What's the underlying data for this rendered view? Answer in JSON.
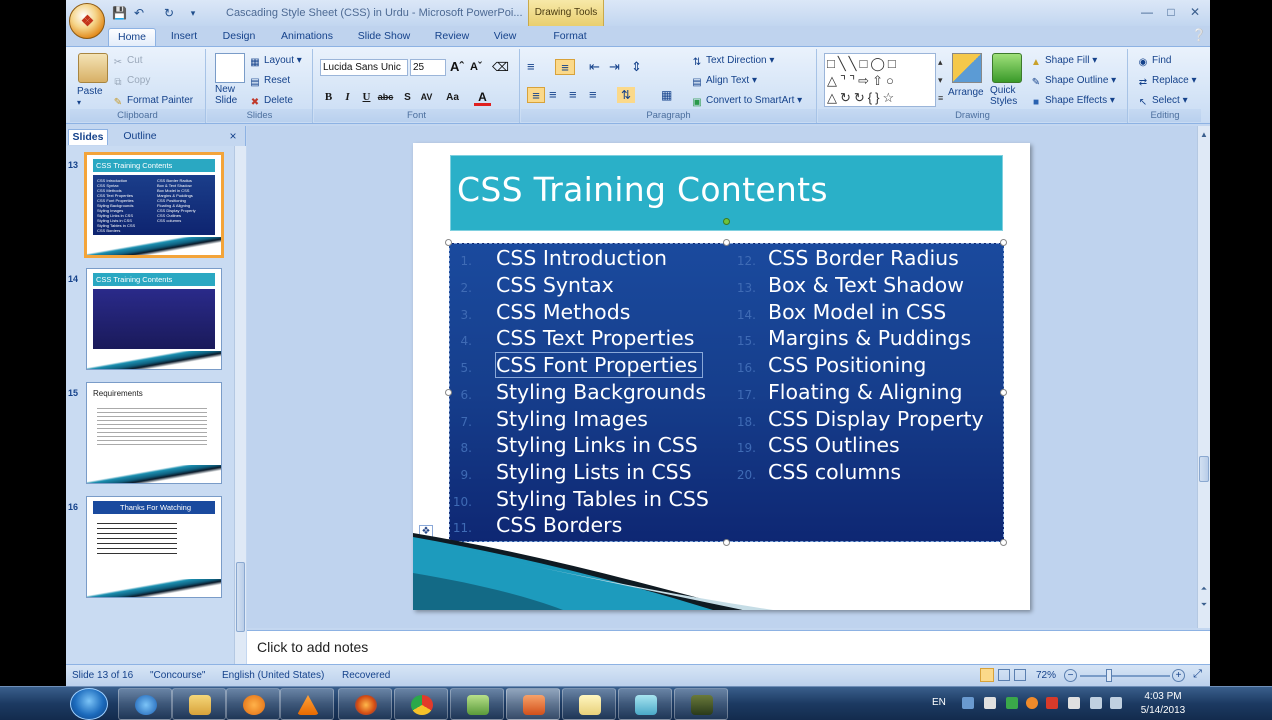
{
  "window": {
    "title": "Cascading Style Sheet (CSS) in Urdu - Microsoft PowerPoi...",
    "context_tab_group": "Drawing Tools"
  },
  "tabs": [
    "Home",
    "Insert",
    "Design",
    "Animations",
    "Slide Show",
    "Review",
    "View",
    "Format"
  ],
  "ribbon": {
    "clipboard": {
      "label": "Clipboard",
      "paste": "Paste",
      "cut": "Cut",
      "copy": "Copy",
      "format_painter": "Format Painter"
    },
    "slides": {
      "label": "Slides",
      "new_slide": "New Slide",
      "new_slide_line1": "New",
      "new_slide_line2": "Slide",
      "layout": "Layout",
      "reset": "Reset",
      "delete": "Delete"
    },
    "font": {
      "label": "Font",
      "family": "Lucida Sans Unic",
      "size": "25"
    },
    "paragraph": {
      "label": "Paragraph",
      "text_direction": "Text Direction",
      "align_text": "Align Text",
      "convert": "Convert to SmartArt"
    },
    "drawing": {
      "label": "Drawing",
      "arrange": "Arrange",
      "quick_styles": "Quick Styles",
      "quick_line1": "Quick",
      "quick_line2": "Styles",
      "shape_fill": "Shape Fill",
      "shape_outline": "Shape Outline",
      "shape_effects": "Shape Effects"
    },
    "editing": {
      "label": "Editing",
      "find": "Find",
      "replace": "Replace",
      "select": "Select"
    }
  },
  "pane": {
    "tab_slides": "Slides",
    "tab_outline": "Outline",
    "close": "×"
  },
  "thumbnails": [
    {
      "num": "13",
      "title": "CSS Training Contents"
    },
    {
      "num": "14",
      "title": "CSS Training Contents"
    },
    {
      "num": "15",
      "title": "Requirements"
    },
    {
      "num": "16",
      "title": "Thanks For Watching"
    }
  ],
  "slide": {
    "title": "CSS Training Contents",
    "left_items": [
      {
        "n": "1.",
        "t": "CSS Introduction"
      },
      {
        "n": "2.",
        "t": "CSS Syntax"
      },
      {
        "n": "3.",
        "t": "CSS Methods"
      },
      {
        "n": "4.",
        "t": "CSS Text Properties"
      },
      {
        "n": "5.",
        "t": "CSS Font Properties"
      },
      {
        "n": "6.",
        "t": "Styling Backgrounds"
      },
      {
        "n": "7.",
        "t": "Styling Images"
      },
      {
        "n": "8.",
        "t": "Styling Links in CSS"
      },
      {
        "n": "9.",
        "t": "Styling Lists in CSS"
      },
      {
        "n": "10.",
        "t": "Styling Tables in CSS"
      },
      {
        "n": "11.",
        "t": "CSS Borders"
      }
    ],
    "right_items": [
      {
        "n": "12.",
        "t": "CSS Border Radius"
      },
      {
        "n": "13.",
        "t": "Box & Text Shadow"
      },
      {
        "n": "14.",
        "t": "Box Model in CSS"
      },
      {
        "n": "15.",
        "t": "Margins & Puddings"
      },
      {
        "n": "16.",
        "t": "CSS Positioning"
      },
      {
        "n": "17.",
        "t": "Floating & Aligning"
      },
      {
        "n": "18.",
        "t": "CSS Display Property"
      },
      {
        "n": "19.",
        "t": "CSS Outlines"
      },
      {
        "n": "20.",
        "t": "CSS columns"
      }
    ]
  },
  "notes_placeholder": "Click to add notes",
  "status": {
    "slide": "Slide 13 of 16",
    "theme": "\"Concourse\"",
    "language": "English (United States)",
    "recovered": "Recovered",
    "zoom": "72%"
  },
  "taskbar": {
    "language": "EN",
    "time": "4:03 PM",
    "date": "5/14/2013"
  },
  "colors": {
    "title_bg": "#2ab0c8",
    "content_bg": "#163e8c",
    "ribbon_bg": "#d6e5f7",
    "selected_thumb_border": "#f3a43a"
  }
}
